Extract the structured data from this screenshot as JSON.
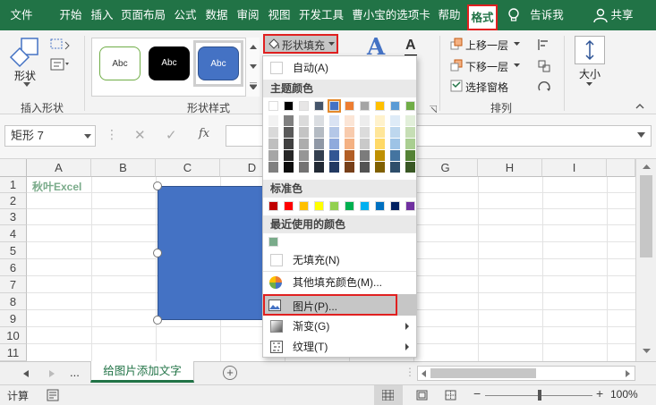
{
  "tabs": [
    {
      "label": "文件",
      "active": false
    },
    {
      "label": "开始",
      "active": false
    },
    {
      "label": "插入",
      "active": false
    },
    {
      "label": "页面布局",
      "active": false
    },
    {
      "label": "公式",
      "active": false
    },
    {
      "label": "数据",
      "active": false
    },
    {
      "label": "审阅",
      "active": false
    },
    {
      "label": "视图",
      "active": false
    },
    {
      "label": "开发工具",
      "active": false
    },
    {
      "label": "曹小宝的选项卡",
      "active": false
    },
    {
      "label": "帮助",
      "active": false
    },
    {
      "label": "格式",
      "active": true
    }
  ],
  "tell_me": "告诉我",
  "share": "共享",
  "ribbon": {
    "shape_button": "形状",
    "insert_shapes_label": "插入形状",
    "style_samples": [
      "Abc",
      "Abc",
      "Abc"
    ],
    "shape_styles_label": "形状样式",
    "shape_fill_button": "形状填充",
    "bring_forward": "上移一层",
    "send_backward": "下移一层",
    "selection_pane": "选择窗格",
    "arrange_label": "排列",
    "size_button": "大小"
  },
  "formula_bar": {
    "name_box": "矩形 7",
    "fx": "fx",
    "cancel": "✕",
    "enter": "✓"
  },
  "grid": {
    "columns": [
      "A",
      "B",
      "C",
      "D",
      "E",
      "F",
      "G",
      "H",
      "I"
    ],
    "rows": [
      "1",
      "2",
      "3",
      "4",
      "5",
      "6",
      "7",
      "8",
      "9",
      "10",
      "11"
    ],
    "cell_a1": "秋叶Excel"
  },
  "fill_menu": {
    "auto": "自动(A)",
    "theme_colors_title": "主题颜色",
    "standard_colors_title": "标准色",
    "recent_colors_title": "最近使用的颜色",
    "no_fill": "无填充(N)",
    "more_colors": "其他填充颜色(M)...",
    "picture": "图片(P)...",
    "gradient": "渐变(G)",
    "texture": "纹理(T)",
    "theme_colors": [
      "#ffffff",
      "#000000",
      "#e7e6e6",
      "#44546a",
      "#4472c4",
      "#ed7d31",
      "#a5a5a5",
      "#ffc000",
      "#5b9bd5",
      "#70ad47"
    ],
    "standard_colors": [
      "#c00000",
      "#ff0000",
      "#ffc000",
      "#ffff00",
      "#92d050",
      "#00b050",
      "#00b0f0",
      "#0070c0",
      "#002060",
      "#7030a0"
    ],
    "recent_colors": [
      "#7aab8a"
    ]
  },
  "sheet_tabs": {
    "ellipsis": "...",
    "active_sheet": "给图片添加文字",
    "add": "+"
  },
  "status": {
    "mode": "计算",
    "zoom": "100%",
    "zoom_minus": "−",
    "zoom_plus": "+"
  },
  "colors": {
    "ribbon_green": "#217346",
    "shape_fill": "#4472c4",
    "highlight_red": "#e02020",
    "a1_text": "#7aab8a"
  }
}
